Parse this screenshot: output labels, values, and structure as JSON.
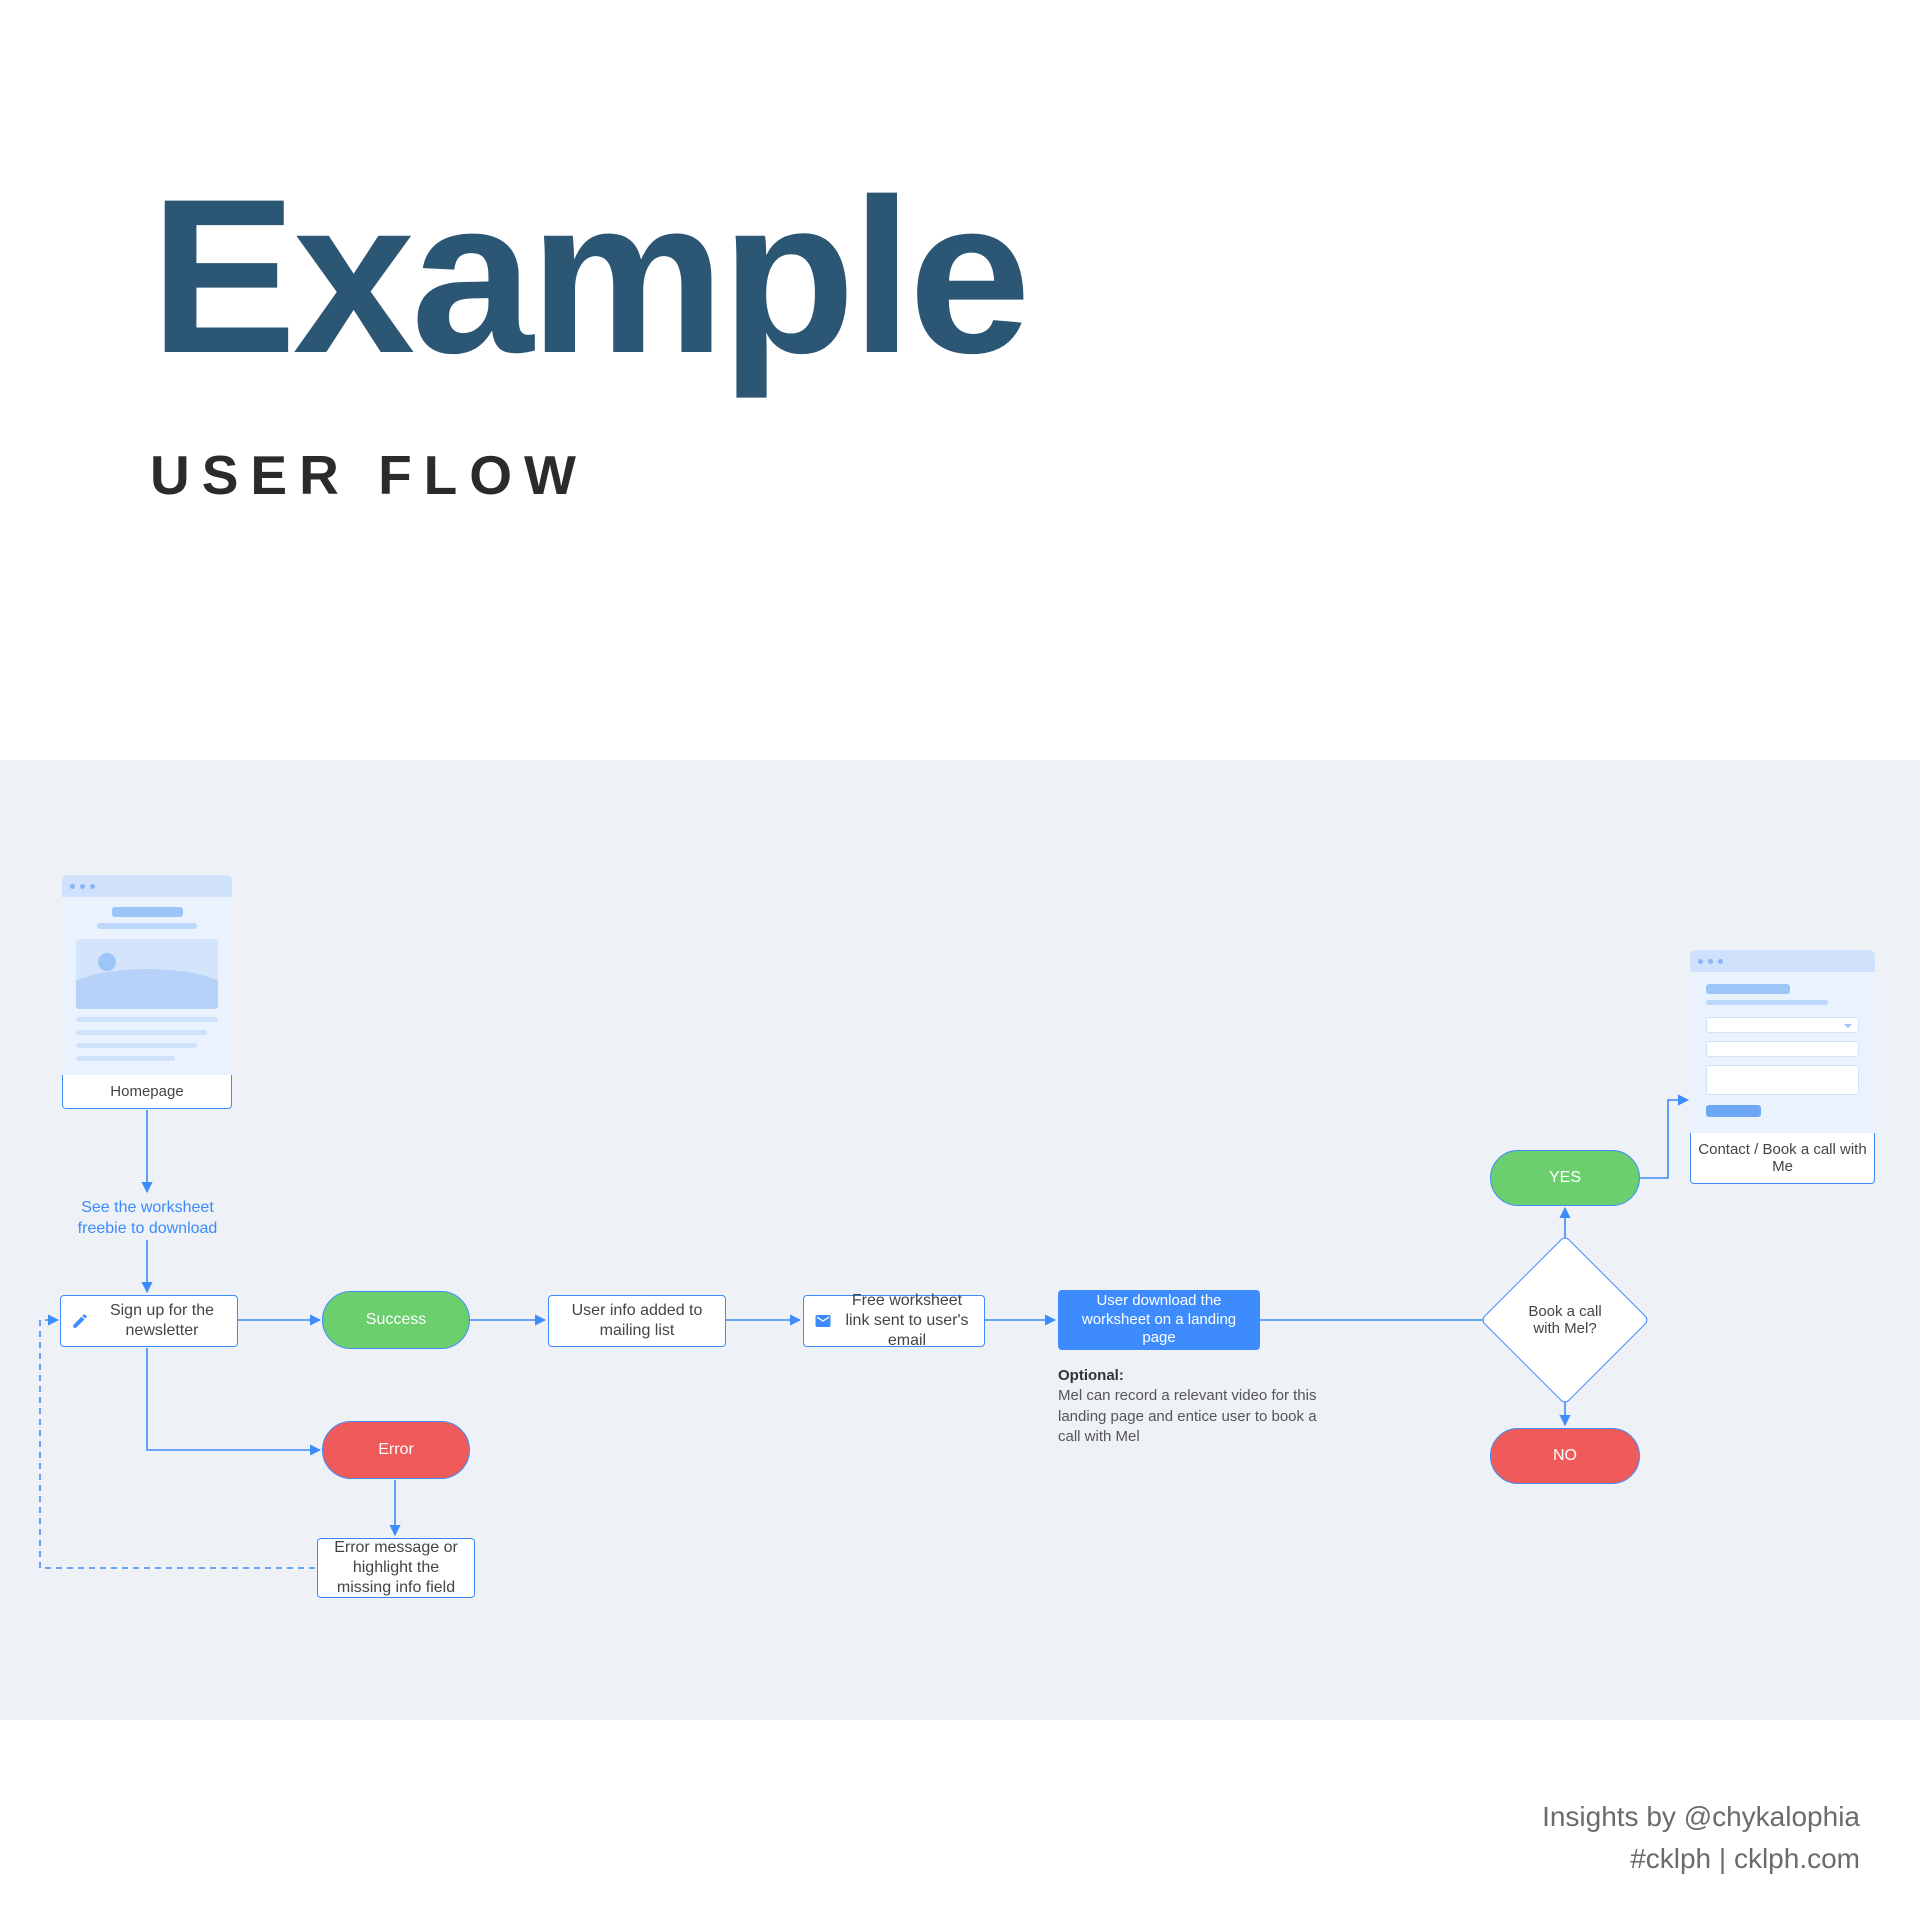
{
  "header": {
    "title": "Example",
    "subtitle": "USER FLOW"
  },
  "flow": {
    "homepage_caption": "Homepage",
    "see_worksheet": "See the worksheet freebie to download",
    "signup": "Sign up for the newsletter",
    "success": "Success",
    "error": "Error",
    "error_detail": "Error message or highlight the missing info field",
    "mailing_list": "User info added to mailing list",
    "email_link": "Free worksheet link sent to user's email",
    "download": "User download the worksheet on a landing page",
    "optional_label": "Optional:",
    "optional_text": "Mel can record a relevant video for this landing page and entice user to book a call with Mel",
    "decision": "Book a call with Mel?",
    "yes": "YES",
    "no": "NO",
    "contact_caption": "Contact / Book a call with Me"
  },
  "footer": {
    "line1": "Insights by @chykalophia",
    "line2": "#cklph | cklph.com"
  },
  "colors": {
    "title": "#2b5674",
    "accent": "#3d8bfd",
    "green": "#6bcf6e",
    "red": "#ef5b5b",
    "canvas": "#eef1f5"
  }
}
